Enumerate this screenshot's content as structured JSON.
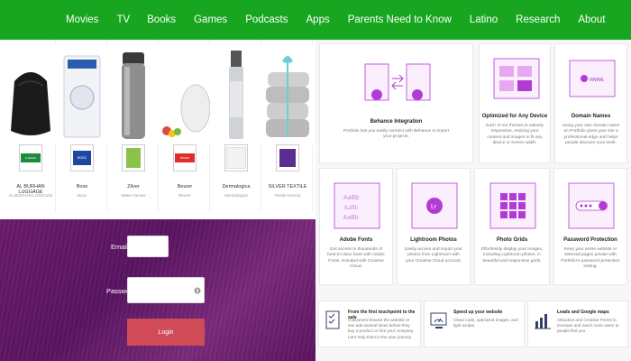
{
  "nav": [
    "Movies",
    "TV",
    "Books",
    "Games",
    "Podcasts",
    "Apps",
    "Parents Need to Know",
    "Latino",
    "Research",
    "About"
  ],
  "products": [
    {
      "name": "AL BURHAN LUGGAGE",
      "sub": "AL BURHAN LUGGAGE",
      "logo": "LUGHAS"
    },
    {
      "name": "Boss",
      "sub": "Boss",
      "logo": "BOSS"
    },
    {
      "name": "Zilver",
      "sub": "Water Genius",
      "logo": ""
    },
    {
      "name": "Beurer",
      "sub": "Beurer",
      "logo": "beurer"
    },
    {
      "name": "Dermalogica",
      "sub": "Dermalogica",
      "logo": ""
    },
    {
      "name": "SILVER TEXTILE",
      "sub": "Textile Factory",
      "logo": ""
    }
  ],
  "login": {
    "email_label": "Email",
    "password_label": "Password",
    "button": "Login"
  },
  "features": [
    {
      "title": "Behance Integration",
      "desc": "Portfolio lets you easily connect with Behance to import your projects."
    },
    {
      "title": "Optimized for Any Device",
      "desc": "Each of our themes is natively responsive, resizing your content and images to fit any device or screen width."
    },
    {
      "title": "Domain Names",
      "desc": "Using your own domain name on Portfolio gives your site a professional edge and helps people discover your work."
    },
    {
      "title": "Adobe Fonts",
      "desc": "Get access to thousands of best-in-class fonts with Adobe Fonts, included with Creative Cloud."
    },
    {
      "title": "Lightroom Photos",
      "desc": "Easily access and import your photos from Lightroom with your Creative Cloud account."
    },
    {
      "title": "Photo Grids",
      "desc": "Effortlessly display your images, including Lightroom photos, in beautiful and responsive grids."
    },
    {
      "title": "Password Protection",
      "desc": "Keep your entire website or selected pages private with Portfolio's password protection setting."
    }
  ],
  "bottom": [
    {
      "title": "From the first touchpoint to the sale",
      "desc": "Customers browse the website or see ads several times before they buy a product or hire your company. Let's help them in the user journey."
    },
    {
      "title": "Speed up your website",
      "desc": "Clean code, optimized images, and light scripts."
    },
    {
      "title": "Leads and Google maps",
      "desc": "Attractive and Creative Forms to increase and reach more users to people find you."
    }
  ],
  "colors": {
    "nav": "#18a51f",
    "accent": "#b23bd6",
    "login_bg": "#5e1864",
    "login_button": "#d04a57"
  },
  "icons": [
    "integration-icon",
    "devices-icon",
    "domain-icon",
    "fonts-icon",
    "lightroom-icon",
    "grid-icon",
    "password-icon",
    "checklist-icon",
    "speed-icon",
    "chart-icon"
  ]
}
